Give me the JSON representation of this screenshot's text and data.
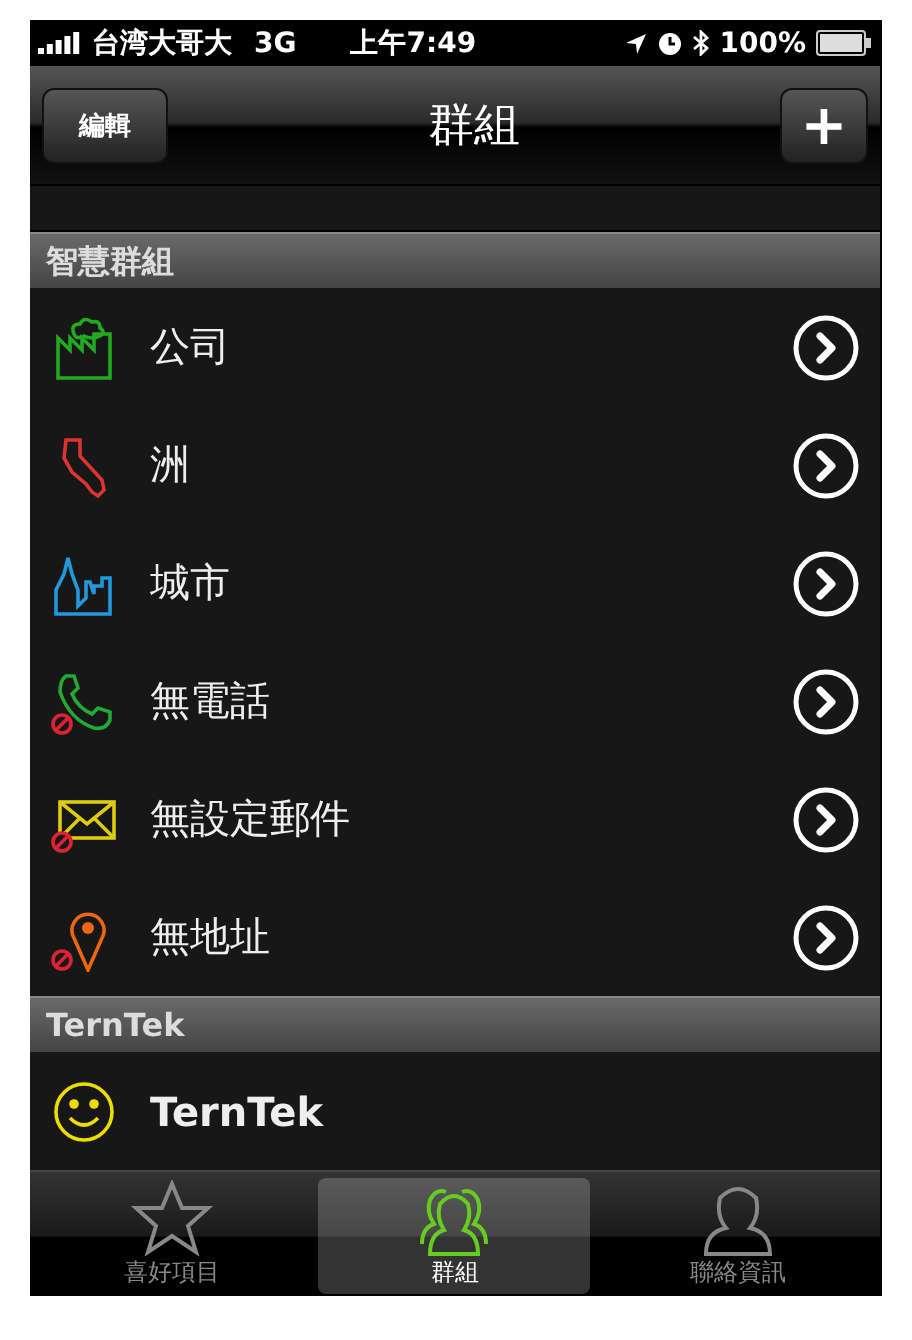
{
  "status_bar": {
    "carrier": "台湾大哥大",
    "network": "3G",
    "time": "上午7:49",
    "battery": "100%"
  },
  "nav_bar": {
    "left_button": "編輯",
    "title": "群組",
    "right_button": "+"
  },
  "sections": [
    {
      "header": "智慧群組",
      "items": [
        {
          "label": "公司",
          "kind": "factory",
          "crossed": false,
          "color": "#22aa22",
          "disclosure": true
        },
        {
          "label": "洲",
          "kind": "state",
          "crossed": false,
          "color": "#dd3333",
          "disclosure": true
        },
        {
          "label": "城市",
          "kind": "city",
          "crossed": false,
          "color": "#2299dd",
          "disclosure": true
        },
        {
          "label": "無電話",
          "kind": "phone",
          "crossed": true,
          "color": "#22aa33",
          "disclosure": true
        },
        {
          "label": "無設定郵件",
          "kind": "mail",
          "crossed": true,
          "color": "#ddcc11",
          "disclosure": true
        },
        {
          "label": "無地址",
          "kind": "pin",
          "crossed": true,
          "color": "#ee6611",
          "disclosure": true
        }
      ]
    },
    {
      "header": "TernTek",
      "items": [
        {
          "label": "TernTek",
          "kind": "smiley",
          "crossed": false,
          "color": "#eedd00",
          "disclosure": false
        }
      ]
    }
  ],
  "tab_bar": [
    {
      "label": "喜好項目",
      "kind": "star",
      "selected": false
    },
    {
      "label": "群組",
      "kind": "people",
      "selected": true
    },
    {
      "label": "聯絡資訊",
      "kind": "person",
      "selected": false
    }
  ]
}
